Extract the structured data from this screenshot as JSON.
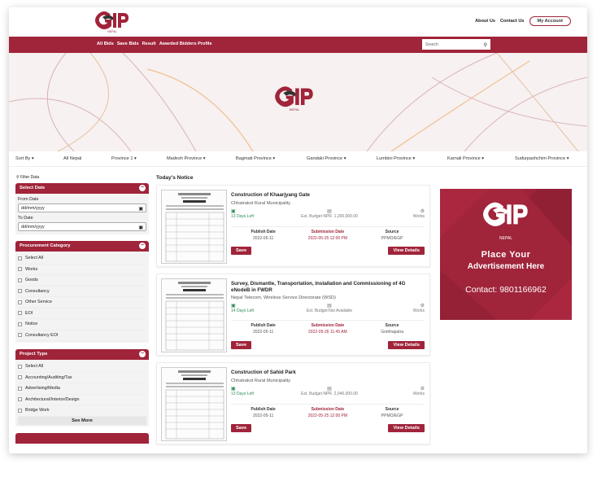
{
  "header": {
    "logo_text": "EGP",
    "logo_sub": "NEPAL",
    "links": [
      "About Us",
      "Contact Us"
    ],
    "account_label": "My Account"
  },
  "nav": {
    "items": [
      "All Bids",
      "Save Bids",
      "Result",
      "Awarded Bidders Profile"
    ],
    "search_placeholder": "Search"
  },
  "provinces": {
    "sort": "Sort By",
    "all": "All Nepal",
    "items": [
      "Province 1",
      "Madesh Province",
      "Bagmati Province",
      "Gandaki Province",
      "Lumbini Province",
      "Karnali Province",
      "Sudurpashchim Province"
    ]
  },
  "sidebar": {
    "filter_title": "Filter Data",
    "select_date": {
      "title": "Select Date",
      "from_label": "From Date",
      "from_value": "dd/mm/yyyy",
      "to_label": "To Date",
      "to_value": "dd/mm/yyyy"
    },
    "procurement": {
      "title": "Procurement Category",
      "items": [
        "Select All",
        "Works",
        "Goods",
        "Consultancy",
        "Other Service",
        "EOI",
        "Notice",
        "Consultancy EOI"
      ]
    },
    "project_type": {
      "title": "Project Type",
      "items": [
        "Select All",
        "Accounting/Auditing/Tax",
        "Advertising/Media",
        "Architectural/Interior/Design",
        "Bridge Work"
      ],
      "see_more": "See More"
    }
  },
  "notices": {
    "title": "Today's Notice",
    "labels": {
      "publish": "Publish Date",
      "submission": "Submission Date",
      "source": "Source",
      "save": "Save",
      "view": "View Details"
    },
    "items": [
      {
        "title": "Construction of Khaarjyang Gate",
        "org": "Chhatrakot Rural Municipality",
        "days_left": "13 Days Left",
        "budget": "Est. Budget NPR. 1,200,000.00",
        "type": "Works",
        "publish_date": "2022-05-11",
        "submission_date": "2022-05-25 12:00 PM",
        "source": "PPMO/EGP"
      },
      {
        "title": "Survey, Dismantle, Transportation, Installation and Commissioning of 4G eNodeB in FWDR",
        "org": "Nepal Telecom, Wireless Service Directorate (WSD)",
        "days_left": "14 Days Left",
        "budget": "Est. Budget:Not Available",
        "type": "Works",
        "publish_date": "2022-05-11",
        "submission_date": "2022-05-26 11:45 AM",
        "source": "Gorkhapatra"
      },
      {
        "title": "Construction of Sahid Park",
        "org": "Chhatrakot Rural Municipality",
        "days_left": "13 Days Left",
        "budget": "Est. Budget NPR. 2,040,000.00",
        "type": "Works",
        "publish_date": "2022-05-11",
        "submission_date": "2022-05-25 12:00 PM",
        "source": "PPMO/EGP"
      }
    ]
  },
  "ad": {
    "logo_text": "EGP",
    "logo_sub": "NEPAL",
    "line1": "Place Your",
    "line2": "Advertisement Here",
    "contact": "Contact: 9801166962"
  },
  "colors": {
    "brand": "#a0243a",
    "days_left": "#2e8b57",
    "banner_bg": "#f7f1f1"
  }
}
